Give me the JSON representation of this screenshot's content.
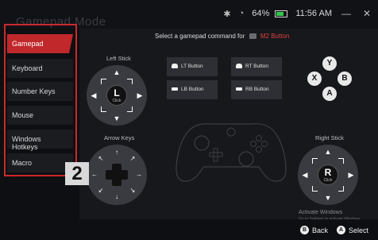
{
  "window": {
    "title": "Gamepad Mode",
    "bluetooth_icon": "bluetooth-icon",
    "wifi_icon": "wifi-icon",
    "battery_percent": "64%",
    "battery_level": 0.64,
    "time": "11:56 AM",
    "minimize_symbol": "—",
    "close_symbol": "✕"
  },
  "sidebar": {
    "items": [
      {
        "label": "Gamepad",
        "active": true
      },
      {
        "label": "Keyboard",
        "active": false
      },
      {
        "label": "Number Keys",
        "active": false
      },
      {
        "label": "Mouse",
        "active": false
      },
      {
        "label": "Windows Hotkeys",
        "active": false
      },
      {
        "label": "Macro",
        "active": false
      }
    ],
    "highlight_color": "#c92a2e",
    "marker_number": "2"
  },
  "main": {
    "instruction_prefix": "Select a gamepad command for",
    "instruction_button": "M2 Button",
    "left_stick": {
      "label": "Left Stick",
      "center_glyph": "L",
      "center_sub": "Click"
    },
    "right_stick": {
      "label": "Right Stick",
      "center_glyph": "R",
      "center_sub": "Click"
    },
    "arrow_keys": {
      "label": "Arrow Keys"
    },
    "buttons": {
      "lt": "LT Button",
      "rt": "RT Button",
      "lb": "LB Button",
      "rb": "RB Button"
    },
    "face_buttons": {
      "y": "Y",
      "x": "X",
      "b": "B",
      "a": "A"
    }
  },
  "watermark": {
    "line1": "Activate Windows",
    "line2": "Go to Settings to activate Windows."
  },
  "bottom": {
    "back_key": "B",
    "back_label": "Back",
    "select_key": "A",
    "select_label": "Select"
  },
  "colors": {
    "accent": "#c0282b",
    "m2_text": "#e0403f",
    "battery": "#33c44b"
  }
}
